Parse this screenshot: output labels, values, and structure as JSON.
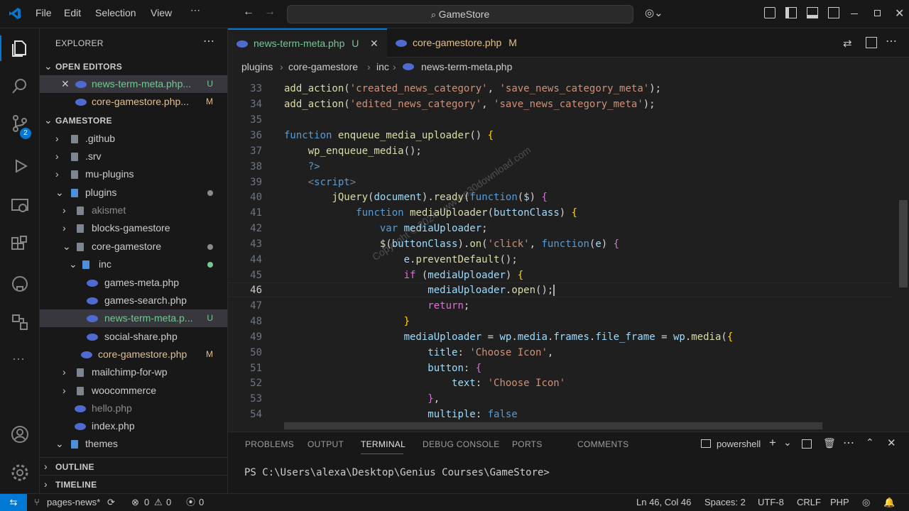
{
  "menu": {
    "file": "File",
    "edit": "Edit",
    "selection": "Selection",
    "view": "View",
    "more": "⋯"
  },
  "command_center": {
    "label": "GameStore"
  },
  "sidebar": {
    "title": "EXPLORER",
    "open_editors": "OPEN EDITORS",
    "open_files": [
      {
        "name": "news-term-meta.php...",
        "status": "U"
      },
      {
        "name": "core-gamestore.php...",
        "status": "M"
      }
    ],
    "project": "GAMESTORE",
    "tree": [
      {
        "name": ".github"
      },
      {
        "name": ".srv"
      },
      {
        "name": "mu-plugins"
      },
      {
        "name": "plugins"
      },
      {
        "name": "akismet"
      },
      {
        "name": "blocks-gamestore"
      },
      {
        "name": "core-gamestore"
      },
      {
        "name": "inc"
      },
      {
        "name": "games-meta.php"
      },
      {
        "name": "games-search.php"
      },
      {
        "name": "news-term-meta.p...",
        "status": "U"
      },
      {
        "name": "social-share.php"
      },
      {
        "name": "core-gamestore.php",
        "status": "M"
      },
      {
        "name": "mailchimp-for-wp"
      },
      {
        "name": "woocommerce"
      },
      {
        "name": "hello.php"
      },
      {
        "name": "index.php"
      },
      {
        "name": "themes"
      }
    ],
    "outline": "OUTLINE",
    "timeline": "TIMELINE",
    "scm_badge": "2"
  },
  "tabs": [
    {
      "label": "news-term-meta.php",
      "status": "U"
    },
    {
      "label": "core-gamestore.php",
      "status": "M"
    }
  ],
  "breadcrumb": [
    "plugins",
    "core-gamestore",
    "inc",
    "news-term-meta.php"
  ],
  "editor": {
    "lines": [
      "33",
      "34",
      "35",
      "36",
      "37",
      "38",
      "39",
      "40",
      "41",
      "42",
      "43",
      "44",
      "45",
      "46",
      "47",
      "48",
      "49",
      "50",
      "51",
      "52",
      "53",
      "54"
    ],
    "watermark": "Copyright © 2024 - www.p30download.com"
  },
  "panel": {
    "tabs": [
      "PROBLEMS",
      "OUTPUT",
      "TERMINAL",
      "DEBUG CONSOLE",
      "PORTS",
      "COMMENTS"
    ],
    "shell": "powershell",
    "prompt": "PS C:\\Users\\alexa\\Desktop\\Genius Courses\\GameStore>"
  },
  "status": {
    "branch": "pages-news*",
    "errors": "0",
    "warnings": "0",
    "ports": "0",
    "position": "Ln 46, Col 46",
    "spaces": "Spaces: 2",
    "encoding": "UTF-8",
    "eol": "CRLF",
    "language": "PHP"
  }
}
